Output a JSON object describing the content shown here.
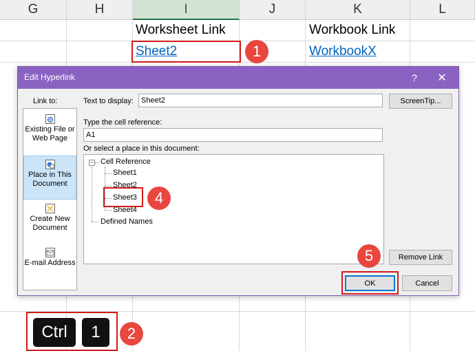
{
  "sheet": {
    "columns": [
      "G",
      "H",
      "I",
      "J",
      "K",
      "L"
    ],
    "selected_column": "I",
    "headers": {
      "worksheet_link": "Worksheet Link",
      "workbook_link": "Workbook Link"
    },
    "links": {
      "sheet_link": "Sheet2",
      "workbook_link": "WorkbookX"
    }
  },
  "dialog": {
    "title": "Edit Hyperlink",
    "help": "?",
    "close": "✕",
    "link_to_label": "Link to:",
    "link_to_items": [
      {
        "label": "Existing File or Web Page",
        "icon": "globe-file-icon"
      },
      {
        "label": "Place in This Document",
        "icon": "document-place-icon",
        "selected": true
      },
      {
        "label": "Create New Document",
        "icon": "new-document-icon"
      },
      {
        "label": "E-mail Address",
        "icon": "email-icon"
      }
    ],
    "text_to_display_label": "Text to display:",
    "text_to_display_value": "Sheet2",
    "screentip_label": "ScreenTip...",
    "cell_reference_label": "Type the cell reference:",
    "cell_reference_value": "A1",
    "place_label": "Or select a place in this document:",
    "tree": {
      "root": "Cell Reference",
      "items": [
        "Sheet1",
        "Sheet2",
        "Sheet3",
        "Sheet4"
      ],
      "selected": "Sheet3",
      "defined_names": "Defined Names"
    },
    "remove_link_label": "Remove Link",
    "ok_label": "OK",
    "cancel_label": "Cancel"
  },
  "shortcut": {
    "keys": [
      "Ctrl",
      "1"
    ]
  },
  "callouts": [
    "1",
    "2",
    "4",
    "5"
  ],
  "colors": {
    "accent": "#8a63c2",
    "callout": "#e8463f",
    "highlight_box": "#d11a1a",
    "link": "#0563c1",
    "selected_item": "#cce4f7"
  }
}
